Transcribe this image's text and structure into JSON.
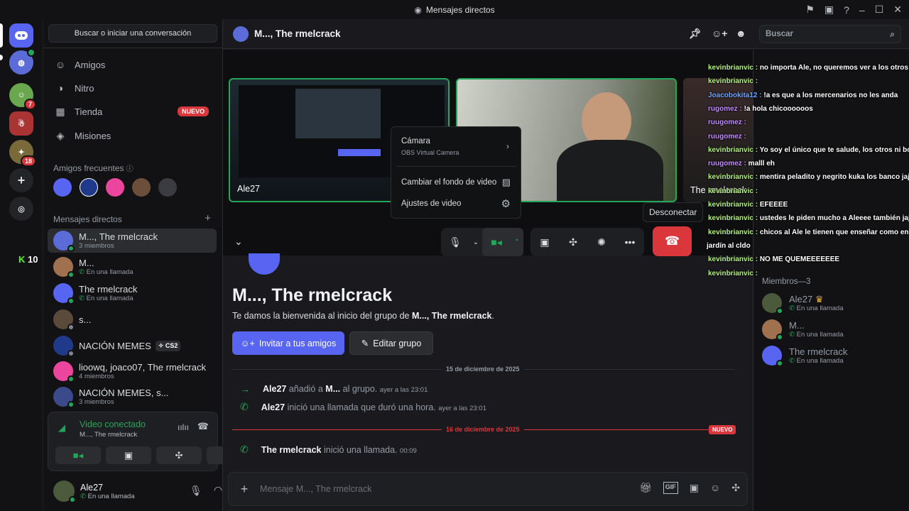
{
  "window": {
    "title": "Mensajes directos"
  },
  "servers": {
    "badges": [
      "7",
      "18"
    ],
    "kick_count": "10"
  },
  "dm_sidebar": {
    "search_label": "Buscar o iniciar una conversación",
    "nav": [
      {
        "label": "Amigos"
      },
      {
        "label": "Nitro"
      },
      {
        "label": "Tienda",
        "badge": "NUEVO"
      },
      {
        "label": "Misiones"
      }
    ],
    "frequent_label": "Amigos frecuentes",
    "dm_label": "Mensajes directos",
    "items": [
      {
        "name": "M..., The rmelcrack",
        "sub": "3 miembros"
      },
      {
        "name": "M...",
        "sub": "En una llamada"
      },
      {
        "name": "The rmelcrack",
        "sub": "En una llamada"
      },
      {
        "name": "s...",
        "sub": ""
      },
      {
        "name": "NACIÓN MEMES",
        "sub": "",
        "tag": "CS2"
      },
      {
        "name": "lioowq, joaco07, The rmelcrack",
        "sub": "4 miembros"
      },
      {
        "name": "NACIÓN MEMES, s...",
        "sub": "3 miembros"
      }
    ]
  },
  "voice": {
    "status": "Video conectado",
    "channel": "M..., The rmelcrack"
  },
  "user": {
    "name": "Ale27",
    "status": "En una llamada"
  },
  "header": {
    "title": "M..., The rmelcrack",
    "search_placeholder": "Buscar"
  },
  "call": {
    "tiles": [
      {
        "label": "Ale27"
      },
      {
        "label": ""
      },
      {
        "label": "The rmelcrack"
      }
    ],
    "tooltip": "Desconectar",
    "menu": {
      "camera_label": "Cámara",
      "camera_sub": "OBS Virtual Camera",
      "bg_label": "Cambiar el fondo de video",
      "settings_label": "Ajustes de video"
    }
  },
  "welcome": {
    "title": "M..., The rmelcrack",
    "sub_prefix": "Te damos la bienvenida al inicio del grupo de ",
    "sub_bold": "M..., The rmelcrack",
    "invite_label": "Invitar a tus amigos",
    "edit_label": "Editar grupo"
  },
  "messages": {
    "date1": "15 de diciembre de 2025",
    "date2": "16 de diciembre de 2025",
    "new_badge": "NUEVO",
    "m1": {
      "user": "Ale27",
      "text1": "añadió a",
      "bold": "M...",
      "text2": "al grupo.",
      "time": "ayer a las 23:01"
    },
    "m2": {
      "user": "Ale27",
      "text": "inició una llamada que duró una hora.",
      "time": "ayer a las 23:01"
    },
    "m3": {
      "user": "The rmelcrack",
      "text": "inició una llamada.",
      "time": "00:09"
    }
  },
  "chat": {
    "placeholder": "Mensaje M..., The rmelcrack"
  },
  "members": {
    "header": "Miembros—3",
    "list": [
      {
        "name": "Ale27",
        "sub": "En una llamada"
      },
      {
        "name": "M...",
        "sub": "En una llamada"
      },
      {
        "name": "The rmelcrack",
        "sub": "En una llamada"
      }
    ]
  },
  "stream_chat": [
    {
      "user": "kevinbrianvic",
      "color": "green",
      "text": "no importa Ale, no queremos ver a los otros jug"
    },
    {
      "user": "kevinbrianvic",
      "color": "green",
      "text": ""
    },
    {
      "user": "Joacobokita12",
      "color": "blue",
      "text": "!a es que a los mercenarios no les anda"
    },
    {
      "user": "rugomez",
      "color": "purple",
      "text": "!a hola chicoooooos"
    },
    {
      "user": "ruugomez",
      "color": "purple",
      "text": ""
    },
    {
      "user": "ruugomez",
      "color": "purple",
      "text": ""
    },
    {
      "user": "kevinbrianvic",
      "color": "green",
      "text": "Yo soy el único que te salude, los otros ni bola"
    },
    {
      "user": "ruugomez",
      "color": "purple",
      "text": "malll eh"
    },
    {
      "user": "kevinbrianvic",
      "color": "green",
      "text": "mentira peladito y negrito kuka los banco jaja"
    },
    {
      "user": "kevinbrianvic",
      "color": "green",
      "text": ""
    },
    {
      "user": "kevinbrianvic",
      "color": "green",
      "text": "EFEEEE"
    },
    {
      "user": "kevinbrianvic",
      "color": "green",
      "text": "ustedes le piden mucho a Aleeee también jaja"
    },
    {
      "user": "kevinbrianvic",
      "color": "green",
      "text": "chicos al Ale le tienen que enseñar como en el"
    },
    {
      "user": "",
      "color": "green",
      "text": "jardín al cldo"
    },
    {
      "user": "kevinbrianvic",
      "color": "green",
      "text": "NO ME QUEMEEEEEEE"
    },
    {
      "user": "kevinbrianvic",
      "color": "green",
      "text": ""
    }
  ],
  "colors": {
    "accent": "#5865f2",
    "danger": "#da373c",
    "online": "#23a55a"
  }
}
